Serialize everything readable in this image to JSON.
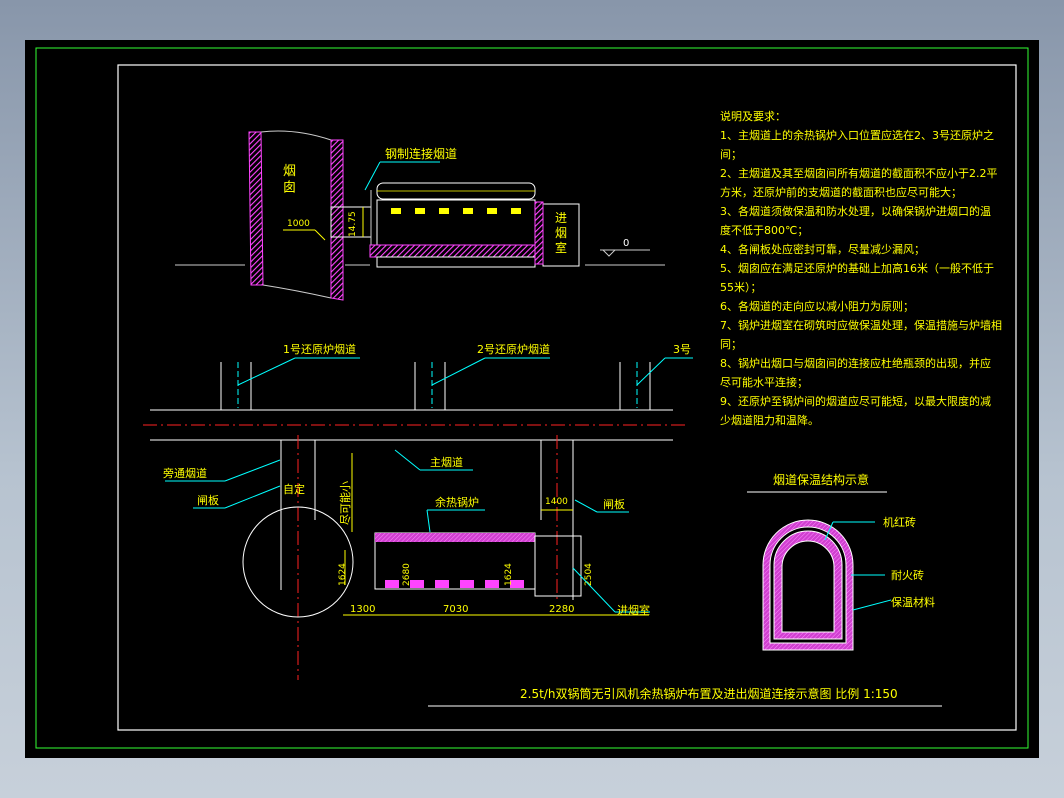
{
  "viewport": {
    "background": "#000000"
  },
  "colors": {
    "frame": "#33ff33",
    "wall": "#ff44ff",
    "dim": "#ffff00",
    "cyan": "#00ffff",
    "red": "#ff2222",
    "white": "#ffffff",
    "mid": "#cccccc"
  },
  "elevation": {
    "chimney_label": "烟\n囱",
    "connection_label": "钢制连接烟道",
    "height_dim": "14.75",
    "dim_1000": "1000",
    "furnace_room": "进\n烟\n室",
    "elev_zero": "0"
  },
  "plan": {
    "flue1": "1号还原炉烟道",
    "flue2": "2号还原炉烟道",
    "flue3": "3号",
    "main_flue": "主烟道",
    "bypass_flue": "旁通烟道",
    "damper_left": "闸板",
    "fixed": "自定",
    "as_possible": "尽可能小",
    "boiler": "余热锅炉",
    "damper_right": "闸板",
    "dim_1400": "1400",
    "dim_1624a": "1624",
    "dim_2680": "2680",
    "dim_1624b": "1624",
    "dim_2504": "2504",
    "dim_1300": "1300",
    "dim_7030": "7030",
    "dim_2280": "2280",
    "intake_room": "进烟室"
  },
  "notes": {
    "heading": "说明及要求：",
    "lines": [
      "1、主烟道上的余热锅炉入口位置应选在2、3号还原炉之",
      "间；",
      "2、主烟道及其至烟囱间所有烟道的截面积不应小于2.2平",
      "方米，还原炉前的支烟道的截面积也应尽可能大；",
      "3、各烟道须做保温和防水处理，以确保锅炉进烟口的温",
      "度不低于800℃；",
      "4、各闸板处应密封可靠，尽量减少漏风；",
      "5、烟囱应在满足还原炉的基础上加高16米（一般不低于",
      "55米）；",
      "6、各烟道的走向应以减小阻力为原则；",
      "7、锅炉进烟室在砌筑时应做保温处理，保温措施与炉墙相",
      "同；",
      "8、锅炉出烟口与烟囱间的连接应杜绝瓶颈的出现，并应",
      "尽可能水平连接；",
      "9、还原炉至锅炉间的烟道应尽可能短，以最大限度的减",
      "少烟道阻力和温降。"
    ]
  },
  "insulation": {
    "title": "烟道保温结构示意",
    "layer1": "机红砖",
    "layer2": "耐火砖",
    "layer3": "保温材料"
  },
  "footer": {
    "title": "2.5t/h双锅筒无引风机余热锅炉布置及进出烟道连接示意图  比例 1:150"
  }
}
